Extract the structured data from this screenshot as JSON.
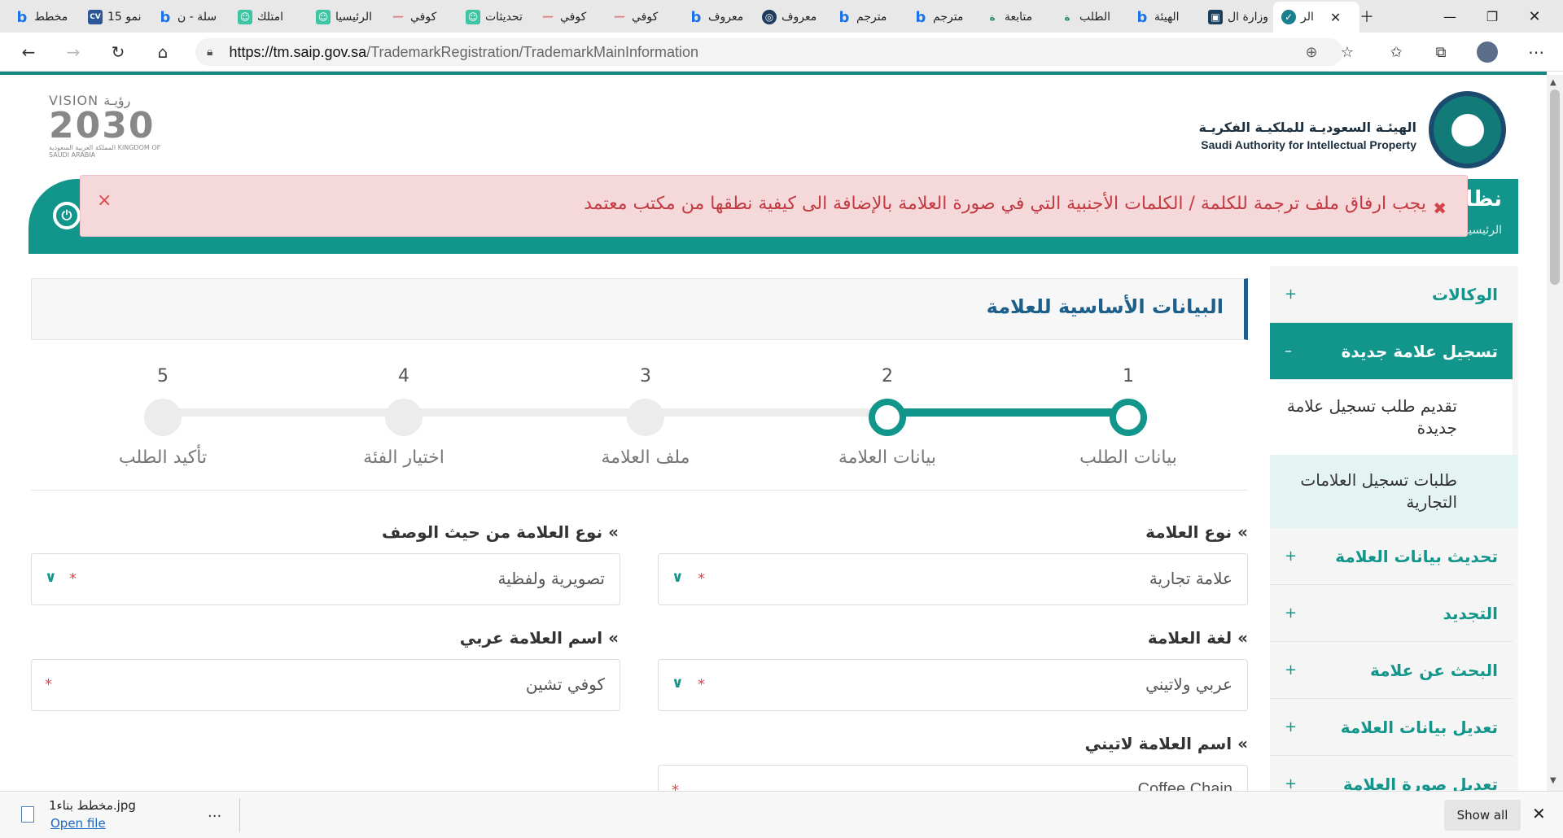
{
  "browser": {
    "tabs": [
      {
        "label": "مخطط",
        "icon": "bing-icon"
      },
      {
        "label": "15 نمو",
        "icon": "cv-icon"
      },
      {
        "label": "سلة - ن",
        "icon": "bing-icon"
      },
      {
        "label": "امتلك",
        "icon": "bot-icon"
      },
      {
        "label": "الرئيسيا",
        "icon": "bot-icon"
      },
      {
        "label": "كوفي",
        "icon": "brand-icon"
      },
      {
        "label": "تحديثات",
        "icon": "bot-icon"
      },
      {
        "label": "كوفي",
        "icon": "brand-icon"
      },
      {
        "label": "كوفي",
        "icon": "brand-icon"
      },
      {
        "label": "معروف",
        "icon": "bing-icon"
      },
      {
        "label": "معروف",
        "icon": "circle-icon"
      },
      {
        "label": "مترجم",
        "icon": "bing-icon"
      },
      {
        "label": "مترجم",
        "icon": "bing-icon"
      },
      {
        "label": "متابعة",
        "icon": "arabic-icon"
      },
      {
        "label": "الطلب",
        "icon": "arabic-icon"
      },
      {
        "label": "الهيئة",
        "icon": "bing-icon"
      },
      {
        "label": "وزارة ال",
        "icon": "ministry-icon"
      },
      {
        "label": "الر",
        "icon": "shield-icon"
      }
    ],
    "url": {
      "host": "https://tm.saip.gov.sa",
      "path": "/TrademarkRegistration/TrademarkMainInformation"
    }
  },
  "header": {
    "vision_label": "VISION رؤيـة",
    "vision_year": "2030",
    "vision_sub": "المملكة العربية السعودية KINGDOM OF SAUDI ARABIA",
    "org_ar": "الهيئـة السعوديـة للملكيـة الفكريـة",
    "org_en": "Saudi Authority for Intellectual Property"
  },
  "banner": {
    "title": "نظا",
    "breadcrumb": "الرئيسية / تسجيل علامة تجارية"
  },
  "alert": {
    "text": "يجب ارفاق ملف ترجمة للكلمة / الكلمات الأجنبية التي في صورة العلامة بالإضافة الى كيفية نطقها من مكتب معتمد",
    "close": "×",
    "icon": "✖"
  },
  "sidebar": {
    "items": [
      {
        "label": "الوكالات",
        "toggle": "+"
      },
      {
        "label": "تسجيل علامة جديدة",
        "toggle": "–"
      },
      {
        "label": "تحديث بيانات العلامة",
        "toggle": "+"
      },
      {
        "label": "التجديد",
        "toggle": "+"
      },
      {
        "label": "البحث عن علامة",
        "toggle": "+"
      },
      {
        "label": "تعديل بيانات العلامة",
        "toggle": "+"
      },
      {
        "label": "تعديل صورة العلامة",
        "toggle": "+"
      }
    ],
    "subitems": [
      {
        "label": "تقديم طلب تسجيل علامة جديدة"
      },
      {
        "label": "طلبات تسجيل العلامات التجارية"
      }
    ]
  },
  "card": {
    "title": "البيانات الأساسية للعلامة"
  },
  "steps": [
    {
      "num": "1",
      "label": "بيانات الطلب",
      "done": true
    },
    {
      "num": "2",
      "label": "بيانات العلامة",
      "done": true
    },
    {
      "num": "3",
      "label": "ملف العلامة",
      "done": false
    },
    {
      "num": "4",
      "label": "اختيار الفئة",
      "done": false
    },
    {
      "num": "5",
      "label": "تأكيد الطلب",
      "done": false
    }
  ],
  "form": {
    "mark_type": {
      "label": "» نوع العلامة",
      "value": "علامة تجارية"
    },
    "desc_type": {
      "label": "» نوع العلامة من حيث الوصف",
      "value": "تصويرية ولفظية"
    },
    "language": {
      "label": "» لغة العلامة",
      "value": "عربي ولاتيني"
    },
    "name_ar": {
      "label": "» اسم العلامة عربي",
      "value": "كوفي تشين"
    },
    "name_en": {
      "label": "» اسم العلامة لاتيني",
      "value": "Coffee Chain"
    },
    "required_mark": "*"
  },
  "download": {
    "filename": "مخطط بناء1.jpg",
    "open_label": "Open file",
    "more": "...",
    "show_all": "Show all",
    "close": "✕"
  },
  "colors": {
    "accent": "#12958a",
    "title_blue": "#1c5f8a",
    "alert_bg": "#f4d8da",
    "alert_text": "#c33a40"
  }
}
